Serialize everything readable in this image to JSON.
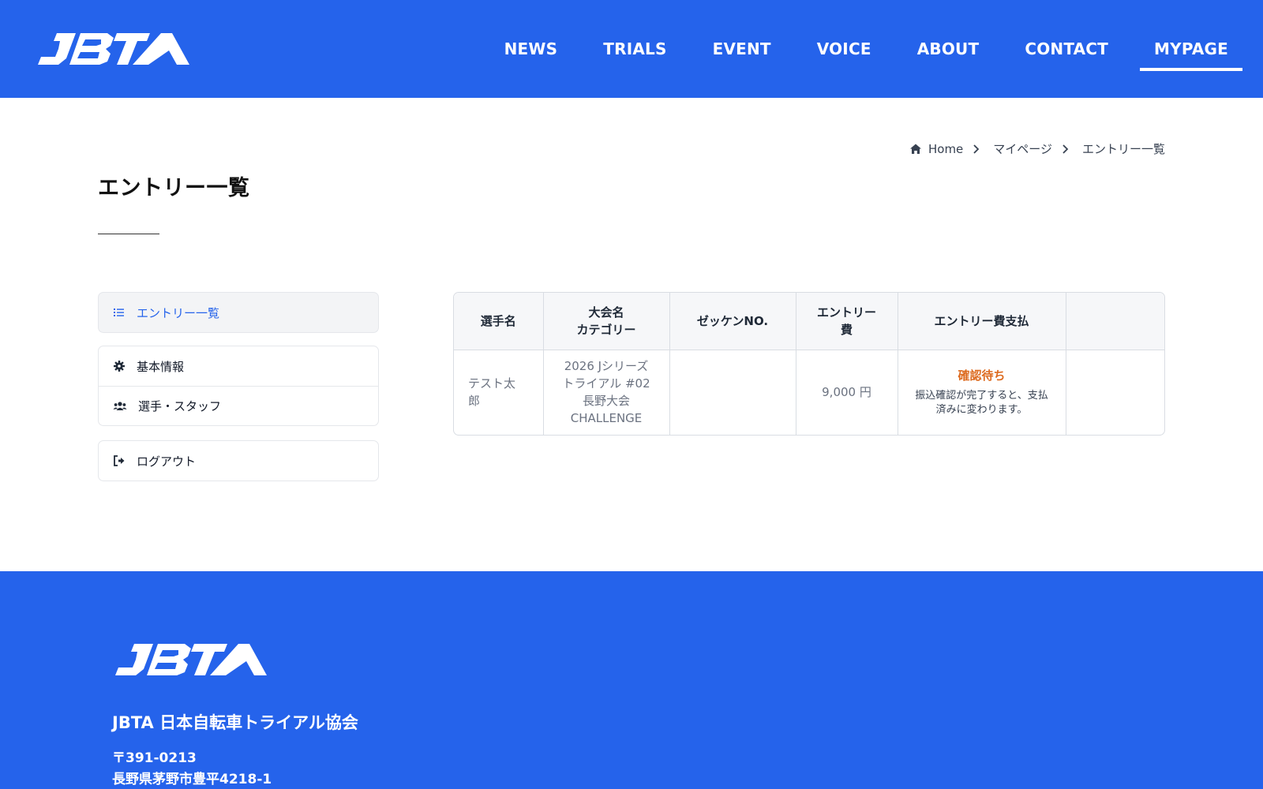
{
  "header": {
    "logo_text": "JBTA",
    "nav": [
      {
        "label": "NEWS"
      },
      {
        "label": "TRIALS"
      },
      {
        "label": "EVENT"
      },
      {
        "label": "VOICE"
      },
      {
        "label": "ABOUT"
      },
      {
        "label": "CONTACT"
      },
      {
        "label": "MYPAGE",
        "active": true
      }
    ]
  },
  "breadcrumb": {
    "home": "Home",
    "items": [
      "マイページ",
      "エントリー一覧"
    ]
  },
  "page": {
    "title": "エントリー一覧"
  },
  "sidebar": {
    "groups": [
      {
        "items": [
          {
            "label": "エントリー一覧",
            "icon": "list-icon",
            "active": true
          }
        ]
      },
      {
        "items": [
          {
            "label": "基本情報",
            "icon": "gear-icon"
          },
          {
            "label": "選手・スタッフ",
            "icon": "users-icon"
          }
        ]
      },
      {
        "items": [
          {
            "label": "ログアウト",
            "icon": "sign-out-icon"
          }
        ]
      }
    ]
  },
  "table": {
    "headers": [
      {
        "line1": "選手名",
        "line2": ""
      },
      {
        "line1": "大会名",
        "line2": "カテゴリー"
      },
      {
        "line1": "ゼッケンNO.",
        "line2": ""
      },
      {
        "line1": "エントリー",
        "line2": "費"
      },
      {
        "line1": "エントリー費支払",
        "line2": ""
      },
      {
        "line1": "",
        "line2": ""
      }
    ],
    "rows": [
      {
        "player": "テスト太郎",
        "event_lines": [
          "2026 Jシリーズ",
          "トライアル #02",
          "長野大会",
          "CHALLENGE"
        ],
        "bib": "",
        "fee": "9,000 円",
        "payment_status": "確認待ち",
        "payment_note": "振込確認が完了すると、支払済みに変わります。",
        "action": ""
      }
    ]
  },
  "footer": {
    "logo_text": "JBTA",
    "org": "JBTA 日本自転車トライアル協会",
    "zip": "〒391-0213",
    "address": "長野県茅野市豊平4218-1"
  },
  "colors": {
    "brand": "#2563eb",
    "status_pending": "#dd6b20"
  }
}
